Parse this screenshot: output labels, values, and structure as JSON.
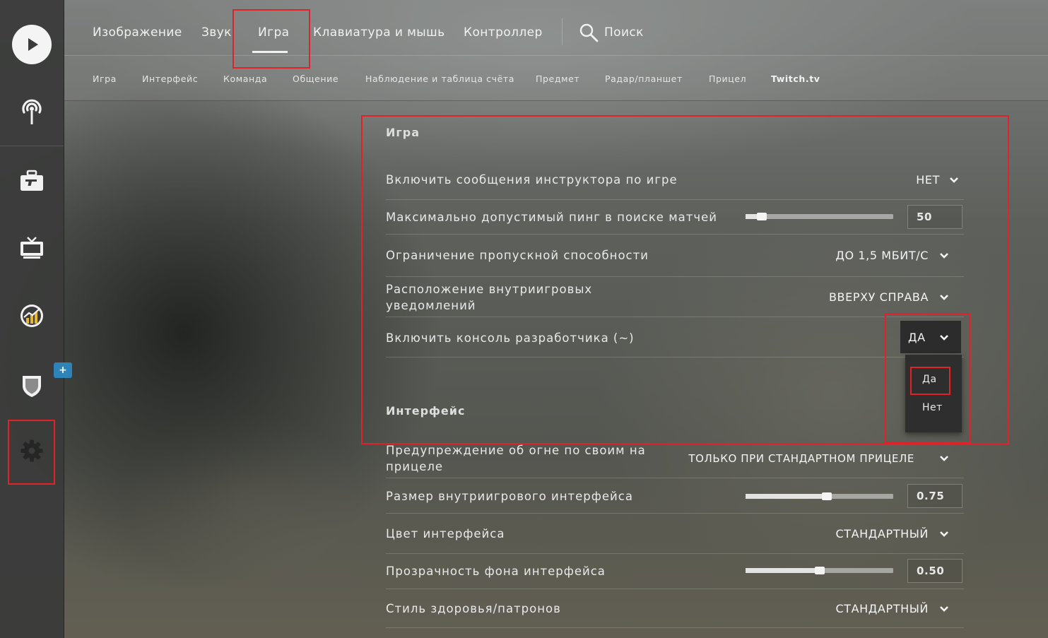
{
  "colors": {
    "accent": "#f1f1f1",
    "annotation": "#e0222b",
    "badge": "#2e84b8"
  },
  "sidebar": {
    "items": [
      {
        "icon": "play-icon"
      },
      {
        "icon": "broadcast-icon"
      },
      {
        "icon": "briefcase-icon"
      },
      {
        "icon": "tv-icon"
      },
      {
        "icon": "stats-icon"
      },
      {
        "icon": "shield-icon",
        "badge": "+"
      },
      {
        "icon": "gear-icon"
      }
    ]
  },
  "nav": {
    "tabs": [
      "Изображение",
      "Звук",
      "Игра",
      "Клавиатура и мышь",
      "Контроллер"
    ],
    "active_tab": "Игра",
    "search_label": "Поиск"
  },
  "subnav": {
    "tabs": [
      "Игра",
      "Интерфейс",
      "Команда",
      "Общение",
      "Наблюдение и таблица счёта",
      "Предмет",
      "Радар/планшет",
      "Прицел",
      "Twitch.tv"
    ]
  },
  "sections": {
    "game": {
      "title": "Игра",
      "rows": [
        {
          "label": "Включить сообщения инструктора по игре",
          "value": "НЕТ"
        },
        {
          "label": "Максимально допустимый пинг в поиске матчей",
          "value": "50",
          "slider_fraction": 0.11
        },
        {
          "label": "Ограничение пропускной способности",
          "value": "ДО 1,5 МБИТ/С"
        },
        {
          "label": "Расположение внутриигровых уведомлений",
          "value": "ВВЕРХУ СПРАВА"
        },
        {
          "label": "Включить консоль разработчика (~)",
          "value": "ДА"
        }
      ]
    },
    "interface": {
      "title": "Интерфейс",
      "rows": [
        {
          "label": "Предупреждение об огне по своим на прицеле",
          "value": "ТОЛЬКО ПРИ СТАНДАРТНОМ ПРИЦЕЛЕ"
        },
        {
          "label": "Размер внутриигрового интерфейса",
          "value": "0.75",
          "slider_fraction": 0.55
        },
        {
          "label": "Цвет интерфейса",
          "value": "СТАНДАРТНЫЙ"
        },
        {
          "label": "Прозрачность фона интерфейса",
          "value": "0.50",
          "slider_fraction": 0.5
        },
        {
          "label": "Стиль здоровья/патронов",
          "value": "СТАНДАРТНЫЙ"
        }
      ]
    }
  },
  "dropdown": {
    "options": [
      "Да",
      "Нет"
    ],
    "highlighted": "Да"
  }
}
